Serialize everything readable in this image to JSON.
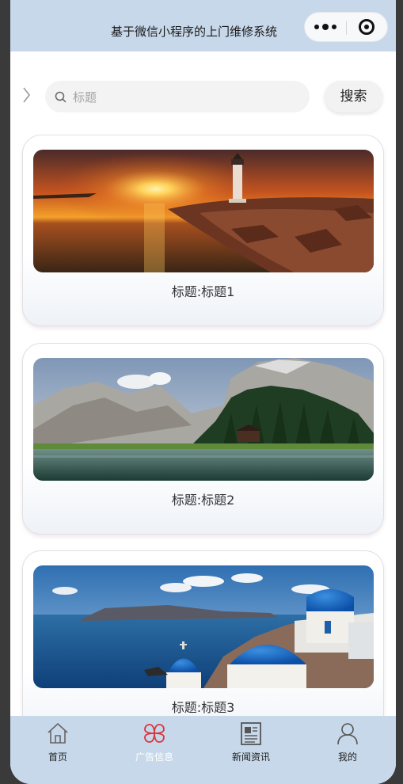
{
  "navbar": {
    "title": "基于微信小程序的上门维修系统",
    "more_icon": "more-dots-icon",
    "close_icon": "capsule-close-icon"
  },
  "search": {
    "placeholder": "标题",
    "value": "",
    "button_label": "搜索"
  },
  "cards": [
    {
      "caption": "标题:标题1",
      "image": "sunset-lighthouse-photo"
    },
    {
      "caption": "标题:标题2",
      "image": "mountain-lake-photo"
    },
    {
      "caption": "标题:标题3",
      "image": "santorini-domes-photo"
    }
  ],
  "tabbar": {
    "items": [
      {
        "label": "首页",
        "icon": "home-icon",
        "active": false
      },
      {
        "label": "广告信息",
        "icon": "clover-icon",
        "active": true
      },
      {
        "label": "新闻资讯",
        "icon": "newspaper-icon",
        "active": false
      },
      {
        "label": "我的",
        "icon": "user-icon",
        "active": false
      }
    ],
    "active_color": "#d9363e"
  },
  "colors": {
    "navbar_bg": "#c7d8ea",
    "tabbar_bg": "#c7d8ea"
  }
}
